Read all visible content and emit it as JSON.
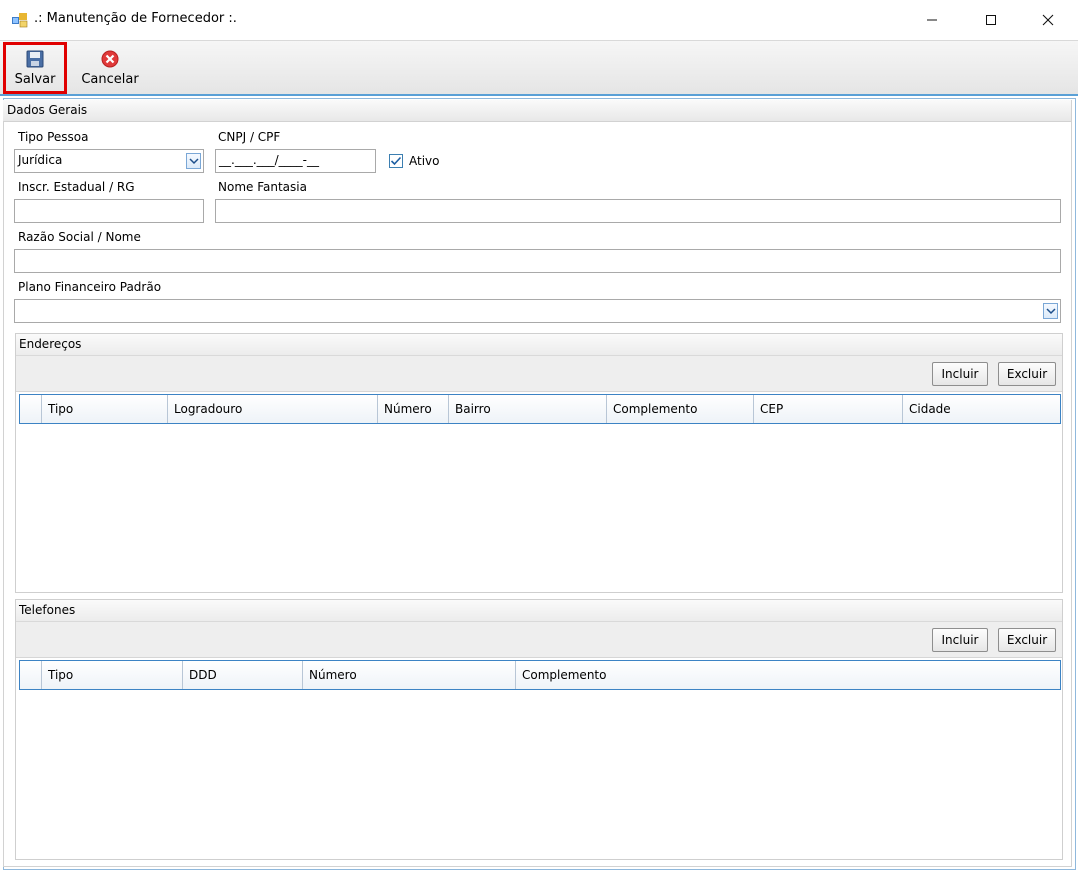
{
  "window": {
    "title": ".: Manutenção de Fornecedor :.",
    "controls": [
      "minimize-icon",
      "maximize-icon",
      "close-icon"
    ]
  },
  "toolbar": {
    "salvar_label": "Salvar",
    "cancelar_label": "Cancelar"
  },
  "dados_gerais": {
    "title": "Dados Gerais",
    "tipo_pessoa_label": "Tipo Pessoa",
    "tipo_pessoa_value": "Jurídica",
    "cnpj_label": "CNPJ / CPF",
    "cnpj_value": "__.___.___/____-__",
    "ativo_label": "Ativo",
    "ativo_checked": true,
    "inscr_label": "Inscr. Estadual / RG",
    "inscr_value": "",
    "fantasia_label": "Nome Fantasia",
    "fantasia_value": "",
    "razao_label": "Razão Social / Nome",
    "razao_value": "",
    "plano_label": "Plano Financeiro Padrão",
    "plano_value": ""
  },
  "enderecos": {
    "title": "Endereços",
    "incluir_label": "Incluir",
    "excluir_label": "Excluir",
    "columns": [
      "Tipo",
      "Logradouro",
      "Número",
      "Bairro",
      "Complemento",
      "CEP",
      "Cidade"
    ]
  },
  "telefones": {
    "title": "Telefones",
    "incluir_label": "Incluir",
    "excluir_label": "Excluir",
    "columns": [
      "Tipo",
      "DDD",
      "Número",
      "Complemento"
    ]
  },
  "colors": {
    "accent": "#3c83c4",
    "highlight_border": "#e00000",
    "cancel_icon": "#e03a3a"
  }
}
